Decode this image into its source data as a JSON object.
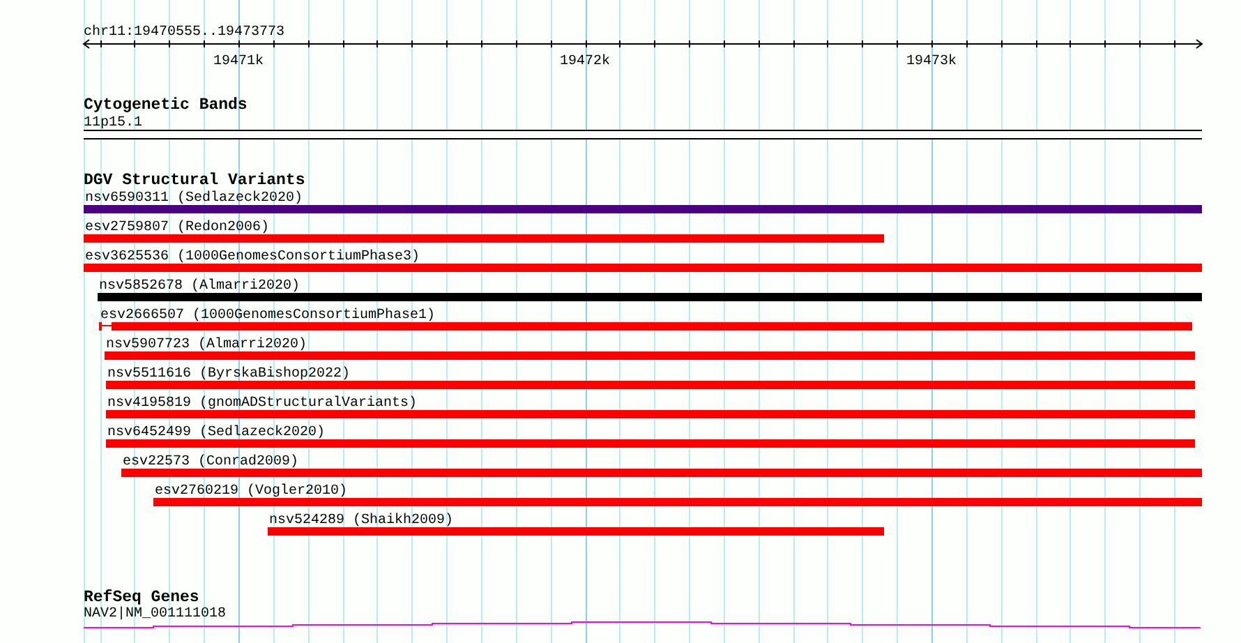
{
  "ruler": {
    "title": "chr11:19470555..19473773",
    "tick_labels": [
      "19471k",
      "19472k",
      "19473k"
    ]
  },
  "cytogenetic_bands": {
    "title": "Cytogenetic Bands",
    "band": "11p15.1"
  },
  "dgv_structural_variants": {
    "title": "DGV Structural Variants",
    "features": [
      {
        "label": "nsv6590311 (Sedlazeck2020)",
        "color": "#4b0082"
      },
      {
        "label": "esv2759807 (Redon2006)",
        "color": "#ff0000"
      },
      {
        "label": "esv3625536 (1000GenomesConsortiumPhase3)",
        "color": "#ff0000"
      },
      {
        "label": "nsv5852678 (Almarri2020)",
        "color": "#000000"
      },
      {
        "label": "esv2666507 (1000GenomesConsortiumPhase1)",
        "color": "#ff0000"
      },
      {
        "label": "nsv5907723 (Almarri2020)",
        "color": "#ff0000"
      },
      {
        "label": "nsv5511616 (ByrskaBishop2022)",
        "color": "#ff0000"
      },
      {
        "label": "nsv4195819 (gnomADStructuralVariants)",
        "color": "#ff0000"
      },
      {
        "label": "nsv6452499 (Sedlazeck2020)",
        "color": "#ff0000"
      },
      {
        "label": "esv22573 (Conrad2009)",
        "color": "#ff0000"
      },
      {
        "label": "esv2760219 (Vogler2010)",
        "color": "#ff0000"
      },
      {
        "label": "nsv524289 (Shaikh2009)",
        "color": "#ff0000"
      }
    ]
  },
  "refseq_genes": {
    "title": "RefSeq Genes",
    "gene": "NAV2|NM_001111018"
  }
}
